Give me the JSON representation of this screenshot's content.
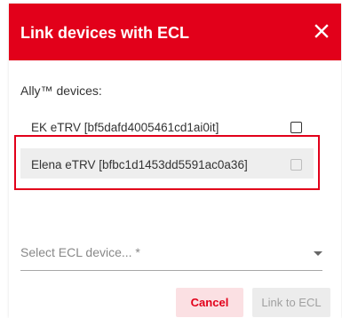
{
  "dialog": {
    "title": "Link devices with ECL",
    "close_icon": "close-icon",
    "section_label": "Ally™ devices:",
    "devices": [
      {
        "label": "EK eTRV [bf5dafd4005461cd1ai0it]",
        "checked": false,
        "disabled": false
      },
      {
        "label": "Elena eTRV [bfbc1d1453dd5591ac0a36]",
        "checked": false,
        "disabled": true
      }
    ],
    "ecl_select": {
      "placeholder": "Select ECL device... *",
      "value": ""
    },
    "buttons": {
      "cancel": "Cancel",
      "link": "Link to ECL"
    }
  },
  "colors": {
    "brand_red": "#e2001a",
    "cancel_bg": "#fbe0e3",
    "disabled_bg": "#ececec",
    "highlight_border": "#e2001a"
  }
}
